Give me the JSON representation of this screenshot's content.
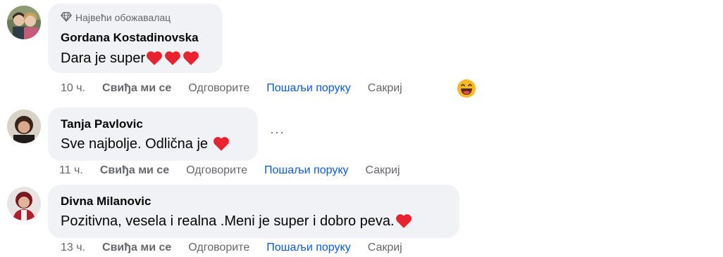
{
  "comments": [
    {
      "badge": "Највећи обожавалац",
      "author": "Gordana Kostadinovska",
      "text": "Dara je super",
      "time": "10 ч.",
      "like": "Свиђа ми се",
      "reply": "Одговорите",
      "message": "Пошаљи поруку",
      "hide": "Сакриј"
    },
    {
      "author": "Tanja Pavlovic",
      "text": "Sve najbolje. Odlična je",
      "time": "11 ч.",
      "like": "Свиђа ми се",
      "reply": "Одговорите",
      "message": "Пошаљи поруку",
      "hide": "Сакриј"
    },
    {
      "author": "Divna Milanovic",
      "text": "Pozitivna, vesela i realna .Meni je super i dobro peva.",
      "time": "13 ч.",
      "like": "Свиђа ми се",
      "reply": "Одговорите",
      "message": "Пошаљи поруку",
      "hide": "Сакриј"
    }
  ],
  "more_options_glyph": "···",
  "icons": {
    "badge": "diamond-icon",
    "heart": "heart-emoji-icon",
    "reaction": "grinning-face-icon"
  },
  "colors": {
    "bubble": "#f0f2f5",
    "secondary_text": "#65676b",
    "link": "#0b5ad4",
    "heart": "#e8232f"
  }
}
